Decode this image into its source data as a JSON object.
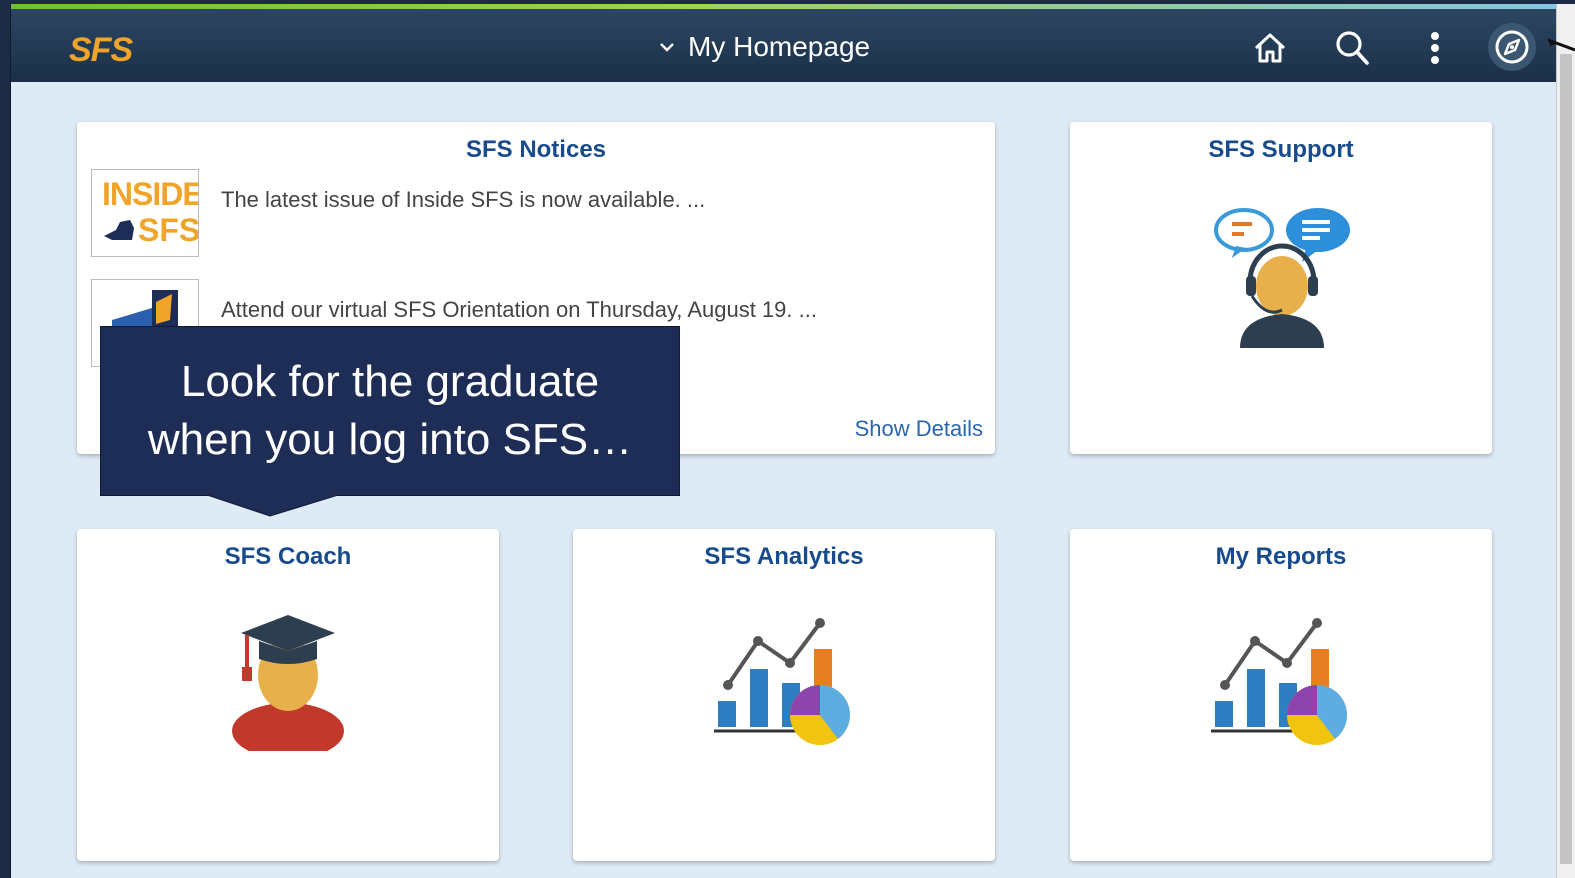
{
  "header": {
    "logo": "SFS",
    "title": "My Homepage",
    "icons": [
      "home-icon",
      "search-icon",
      "actions-menu-icon",
      "navbar-icon"
    ]
  },
  "tiles": {
    "notices": {
      "title": "SFS Notices",
      "items": [
        {
          "text": "The latest issue of Inside SFS is now available. ...",
          "thumb_line1": "INSIDE",
          "thumb_line2": "SFS"
        },
        {
          "text": "Attend our virtual SFS Orientation on Thursday, August 19. ..."
        }
      ],
      "show_details": "Show Details"
    },
    "support": {
      "title": "SFS Support",
      "icon": "support-agent-icon"
    },
    "coach": {
      "title": "SFS Coach",
      "icon": "graduate-icon"
    },
    "analytics": {
      "title": "SFS Analytics",
      "icon": "analytics-chart-icon"
    },
    "reports": {
      "title": "My Reports",
      "icon": "reports-chart-icon"
    }
  },
  "callout": {
    "line1": "Look for the graduate",
    "line2": "when you log into SFS…"
  },
  "colors": {
    "header": "#1f3550",
    "logo": "#f0a52a",
    "tile_title": "#174b8b",
    "callout": "#1e2d56",
    "page_bg": "#deebf6"
  }
}
